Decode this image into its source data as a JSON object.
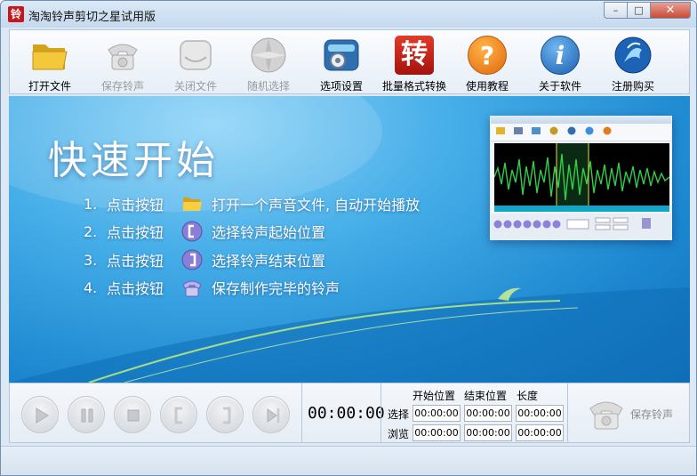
{
  "window": {
    "title": "淘淘铃声剪切之星试用版",
    "app_icon_char": "铃",
    "controls": {
      "minimize": "–",
      "maximize": "□",
      "close": "✕"
    }
  },
  "toolbar": {
    "items": [
      {
        "label": "打开文件",
        "icon": "folder-icon",
        "enabled": true
      },
      {
        "label": "保存铃声",
        "icon": "phone-icon",
        "enabled": false
      },
      {
        "label": "关闭文件",
        "icon": "close-file-icon",
        "enabled": false
      },
      {
        "label": "随机选择",
        "icon": "shuffle-disc-icon",
        "enabled": false
      },
      {
        "label": "选项设置",
        "icon": "gear-window-icon",
        "enabled": true
      },
      {
        "label": "批量格式转换",
        "icon": "convert-icon",
        "icon_text": "转",
        "enabled": true
      },
      {
        "label": "使用教程",
        "icon": "help-icon",
        "icon_text": "?",
        "enabled": true
      },
      {
        "label": "关于软件",
        "icon": "info-icon",
        "icon_text": "i",
        "enabled": true
      },
      {
        "label": "注册购买",
        "icon": "register-icon",
        "enabled": true
      }
    ]
  },
  "banner": {
    "title": "快速开始",
    "steps": [
      {
        "num": "1.",
        "action": "点击按钮",
        "icon": "folder-icon",
        "text": "打开一个声音文件, 自动开始播放"
      },
      {
        "num": "2.",
        "action": "点击按钮",
        "icon": "start-mark-icon",
        "text": "选择铃声起始位置"
      },
      {
        "num": "3.",
        "action": "点击按钮",
        "icon": "end-mark-icon",
        "text": "选择铃声结束位置"
      },
      {
        "num": "4.",
        "action": "点击按钮",
        "icon": "phone-icon",
        "text": "保存制作完毕的铃声"
      }
    ]
  },
  "player": {
    "buttons": [
      "play-icon",
      "pause-icon",
      "stop-icon",
      "set-start-icon",
      "set-end-icon",
      "play-selection-icon"
    ],
    "time": "00:00:00",
    "columns": [
      "开始位置",
      "结束位置",
      "长度"
    ],
    "rows": [
      {
        "label": "选择",
        "values": [
          "00:00:00",
          "00:00:00",
          "00:00:00"
        ]
      },
      {
        "label": "浏览",
        "values": [
          "00:00:00",
          "00:00:00",
          "00:00:00"
        ]
      }
    ],
    "save_label": "保存铃声"
  },
  "colors": {
    "accent_red": "#c8161d",
    "banner_blue": "#1b86cf"
  }
}
